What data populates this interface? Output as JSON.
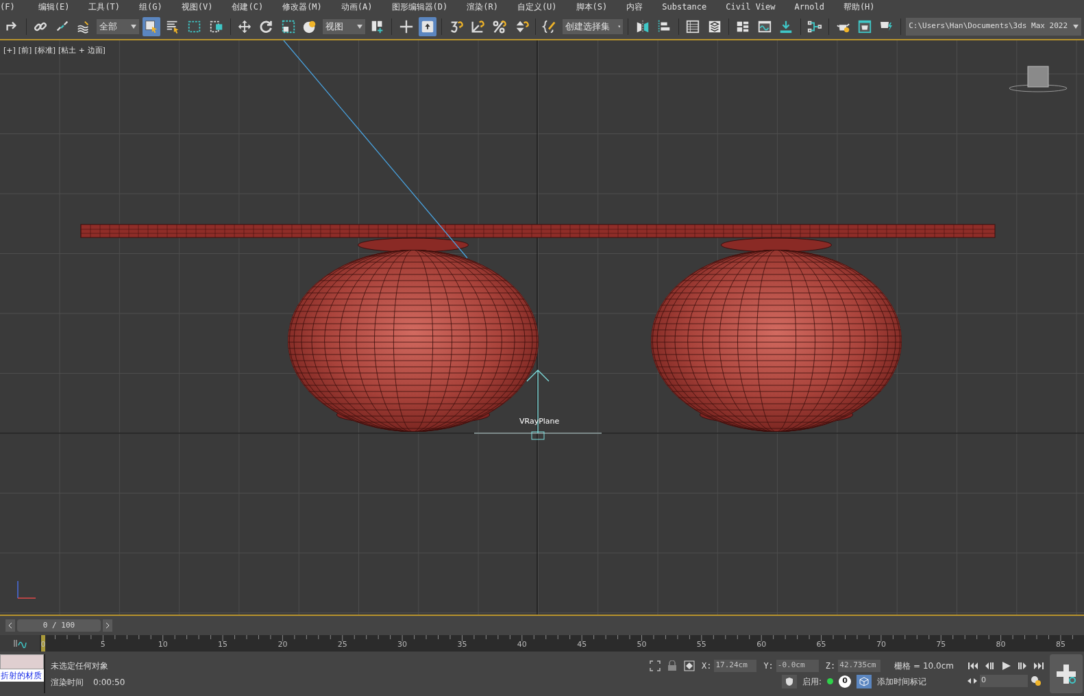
{
  "menu": [
    "(F)",
    "编辑(E)",
    "工具(T)",
    "组(G)",
    "视图(V)",
    "创建(C)",
    "修改器(M)",
    "动画(A)",
    "图形编辑器(D)",
    "渲染(R)",
    "自定义(U)",
    "脚本(S)",
    "内容",
    "Substance",
    "Civil View",
    "Arnold",
    "帮助(H)"
  ],
  "toolbar": [
    {
      "kind": "redo",
      "selected": false
    },
    {
      "kind": "separator"
    },
    {
      "kind": "link",
      "selected": false
    },
    {
      "kind": "unlink",
      "selected": false
    },
    {
      "kind": "bind",
      "selected": false
    },
    {
      "kind": "dropdown",
      "value": "全部"
    },
    {
      "kind": "select",
      "selected": true
    },
    {
      "kind": "select-list",
      "selected": false
    },
    {
      "kind": "rect-region",
      "selected": false
    },
    {
      "kind": "window-crossing",
      "selected": false
    },
    {
      "kind": "separator"
    },
    {
      "kind": "move",
      "selected": false
    },
    {
      "kind": "rotate",
      "selected": false
    },
    {
      "kind": "scale",
      "selected": false
    },
    {
      "kind": "placement",
      "selected": false
    },
    {
      "kind": "dropdown",
      "value": "视图"
    },
    {
      "kind": "pivot",
      "selected": false
    },
    {
      "kind": "separator"
    },
    {
      "kind": "manipulate",
      "selected": false
    },
    {
      "kind": "override",
      "selected": true
    },
    {
      "kind": "separator"
    },
    {
      "kind": "snap",
      "selected": false
    },
    {
      "kind": "angle-snap",
      "selected": false
    },
    {
      "kind": "percent-snap",
      "selected": false
    },
    {
      "kind": "spinner-snap",
      "selected": false
    },
    {
      "kind": "separator"
    },
    {
      "kind": "edit-sets",
      "selected": false
    },
    {
      "kind": "dropdown",
      "value": "创建选择集"
    },
    {
      "kind": "separator"
    },
    {
      "kind": "mirror",
      "selected": false
    },
    {
      "kind": "align",
      "selected": false
    },
    {
      "kind": "separator"
    },
    {
      "kind": "table",
      "selected": false
    },
    {
      "kind": "layers",
      "selected": false
    },
    {
      "kind": "separator"
    },
    {
      "kind": "panels",
      "selected": false
    },
    {
      "kind": "curve",
      "selected": false
    },
    {
      "kind": "download",
      "selected": false
    },
    {
      "kind": "separator"
    },
    {
      "kind": "schematic",
      "selected": false
    },
    {
      "kind": "separator"
    },
    {
      "kind": "teapot-gear",
      "selected": false
    },
    {
      "kind": "teapot-frame",
      "selected": false
    },
    {
      "kind": "teapot-bolt",
      "selected": false
    },
    {
      "kind": "separator"
    },
    {
      "kind": "path",
      "value": "C:\\Users\\Han\\Documents\\3ds Max 2022"
    }
  ],
  "viewport": {
    "labels": [
      "[+]",
      "[前]",
      "[标准]",
      "[粘土 + 边面]"
    ],
    "object_label": "VRayPlane"
  },
  "timeline": {
    "frame_display": "0 / 100",
    "ruler_labels": [
      "0",
      "5",
      "10",
      "15",
      "20",
      "25",
      "30",
      "35",
      "40",
      "45",
      "50",
      "55",
      "60",
      "65",
      "70",
      "75",
      "80",
      "85"
    ]
  },
  "status": {
    "material": "折射的材质",
    "selection": "未选定任何对象",
    "render_time_label": "渲染时间",
    "render_time": "0:00:50",
    "coords": [
      {
        "label": "X:",
        "value": "17.24cm"
      },
      {
        "label": "Y:",
        "value": "-0.0cm"
      },
      {
        "label": "Z:",
        "value": "42.735cm"
      }
    ],
    "grid": "栅格 = 10.0cm",
    "enable_label": "启用:",
    "badge": "0",
    "add_time_tag": "添加时间标记",
    "frame": "0"
  }
}
